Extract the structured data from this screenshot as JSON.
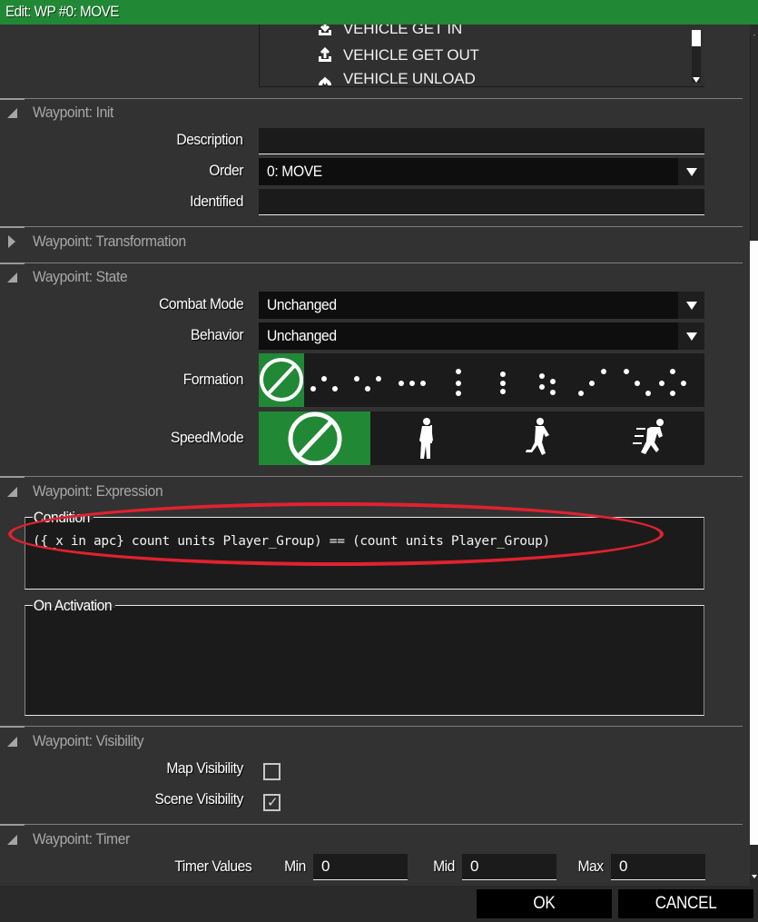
{
  "window": {
    "title": "Edit: WP #0: MOVE"
  },
  "type_list": {
    "items": [
      {
        "label": "VEHICLE GET IN",
        "icon": "vehicle-get-in-icon"
      },
      {
        "label": "VEHICLE GET OUT",
        "icon": "vehicle-get-out-icon"
      },
      {
        "label": "VEHICLE UNLOAD",
        "icon": "vehicle-unload-icon"
      }
    ]
  },
  "sections": {
    "init": {
      "title": "Waypoint: Init",
      "expanded": true,
      "description_label": "Description",
      "description_value": "",
      "order_label": "Order",
      "order_value": "0: MOVE",
      "identified_label": "Identified",
      "identified_value": ""
    },
    "transformation": {
      "title": "Waypoint: Transformation",
      "expanded": false
    },
    "state": {
      "title": "Waypoint: State",
      "expanded": true,
      "combat_mode_label": "Combat Mode",
      "combat_mode_value": "Unchanged",
      "behavior_label": "Behavior",
      "behavior_value": "Unchanged",
      "formation_label": "Formation",
      "formation_options": [
        "no-change",
        "wedge",
        "vee",
        "line",
        "column",
        "file",
        "staggered-column",
        "echelon-left",
        "echelon-right",
        "diamond"
      ],
      "formation_selected": "no-change",
      "speed_label": "SpeedMode",
      "speed_options": [
        "no-change",
        "limited",
        "normal",
        "full"
      ],
      "speed_selected": "no-change"
    },
    "expression": {
      "title": "Waypoint: Expression",
      "expanded": true,
      "condition_label": "Condition",
      "condition_value": "({_x in apc} count units Player_Group) == (count units Player_Group)",
      "activation_label": "On Activation",
      "activation_value": ""
    },
    "visibility": {
      "title": "Waypoint: Visibility",
      "expanded": true,
      "map_label": "Map Visibility",
      "map_checked": false,
      "scene_label": "Scene Visibility",
      "scene_checked": true
    },
    "timer": {
      "title": "Waypoint: Timer",
      "expanded": true,
      "values_label": "Timer Values",
      "min_label": "Min",
      "min_value": "0",
      "mid_label": "Mid",
      "mid_value": "0",
      "max_label": "Max",
      "max_value": "0"
    }
  },
  "footer": {
    "ok_label": "OK",
    "cancel_label": "CANCEL"
  },
  "colors": {
    "accent": "#218836",
    "highlight": "#e0222f",
    "background": "#323232"
  },
  "check_glyph": "✓"
}
